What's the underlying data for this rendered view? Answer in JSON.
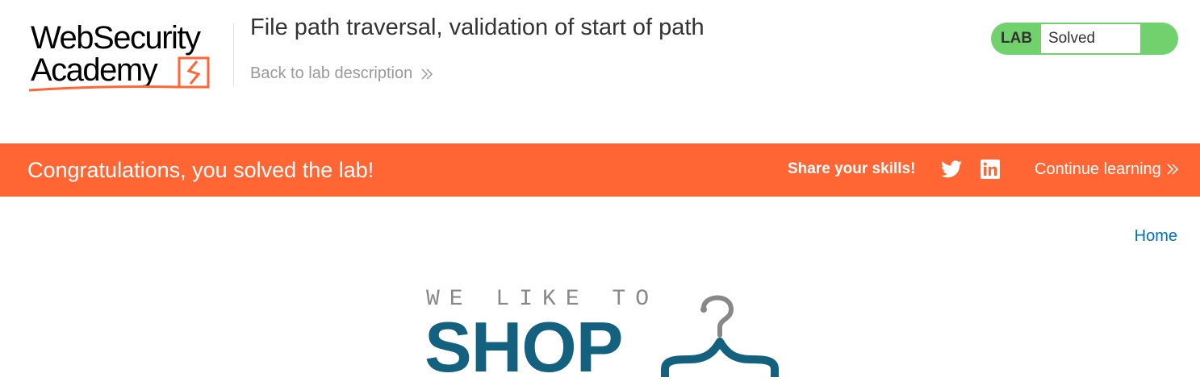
{
  "header": {
    "logo": {
      "line1": "WebSecurity",
      "line2": "Academy"
    },
    "title": "File path traversal, validation of start of path",
    "back_link": "Back to lab description"
  },
  "lab_status": {
    "label": "LAB",
    "state": "Solved",
    "color": "#70d16d"
  },
  "banner": {
    "message": "Congratulations, you solved the lab!",
    "share": "Share your skills!",
    "continue": "Continue learning",
    "color": "#ff6633"
  },
  "nav": {
    "home": "Home"
  },
  "shop_logo": {
    "tagline": "WE LIKE TO",
    "title": "SHOP",
    "color": "#13607f"
  }
}
